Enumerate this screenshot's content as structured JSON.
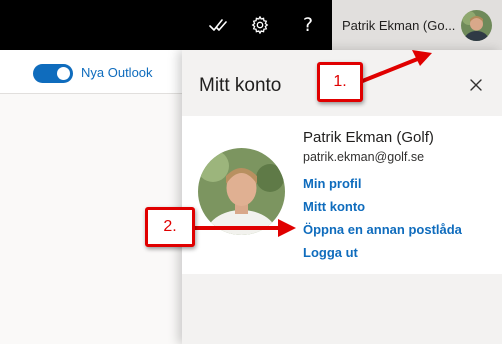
{
  "topbar": {
    "account_name": "Patrik Ekman (Go..."
  },
  "toolbar": {
    "toggle_label": "Nya Outlook",
    "toggle_on": true
  },
  "panel": {
    "title": "Mitt konto",
    "user_name": "Patrik Ekman (Golf)",
    "email": "patrik.ekman@golf.se",
    "links": [
      "Min profil",
      "Mitt konto",
      "Öppna en annan postlåda",
      "Logga ut"
    ]
  },
  "annotations": {
    "callout_1": "1.",
    "callout_2": "2."
  },
  "colors": {
    "accent": "#0f6cbd",
    "annotation_red": "#e00000",
    "topbar_bg": "#000000"
  }
}
